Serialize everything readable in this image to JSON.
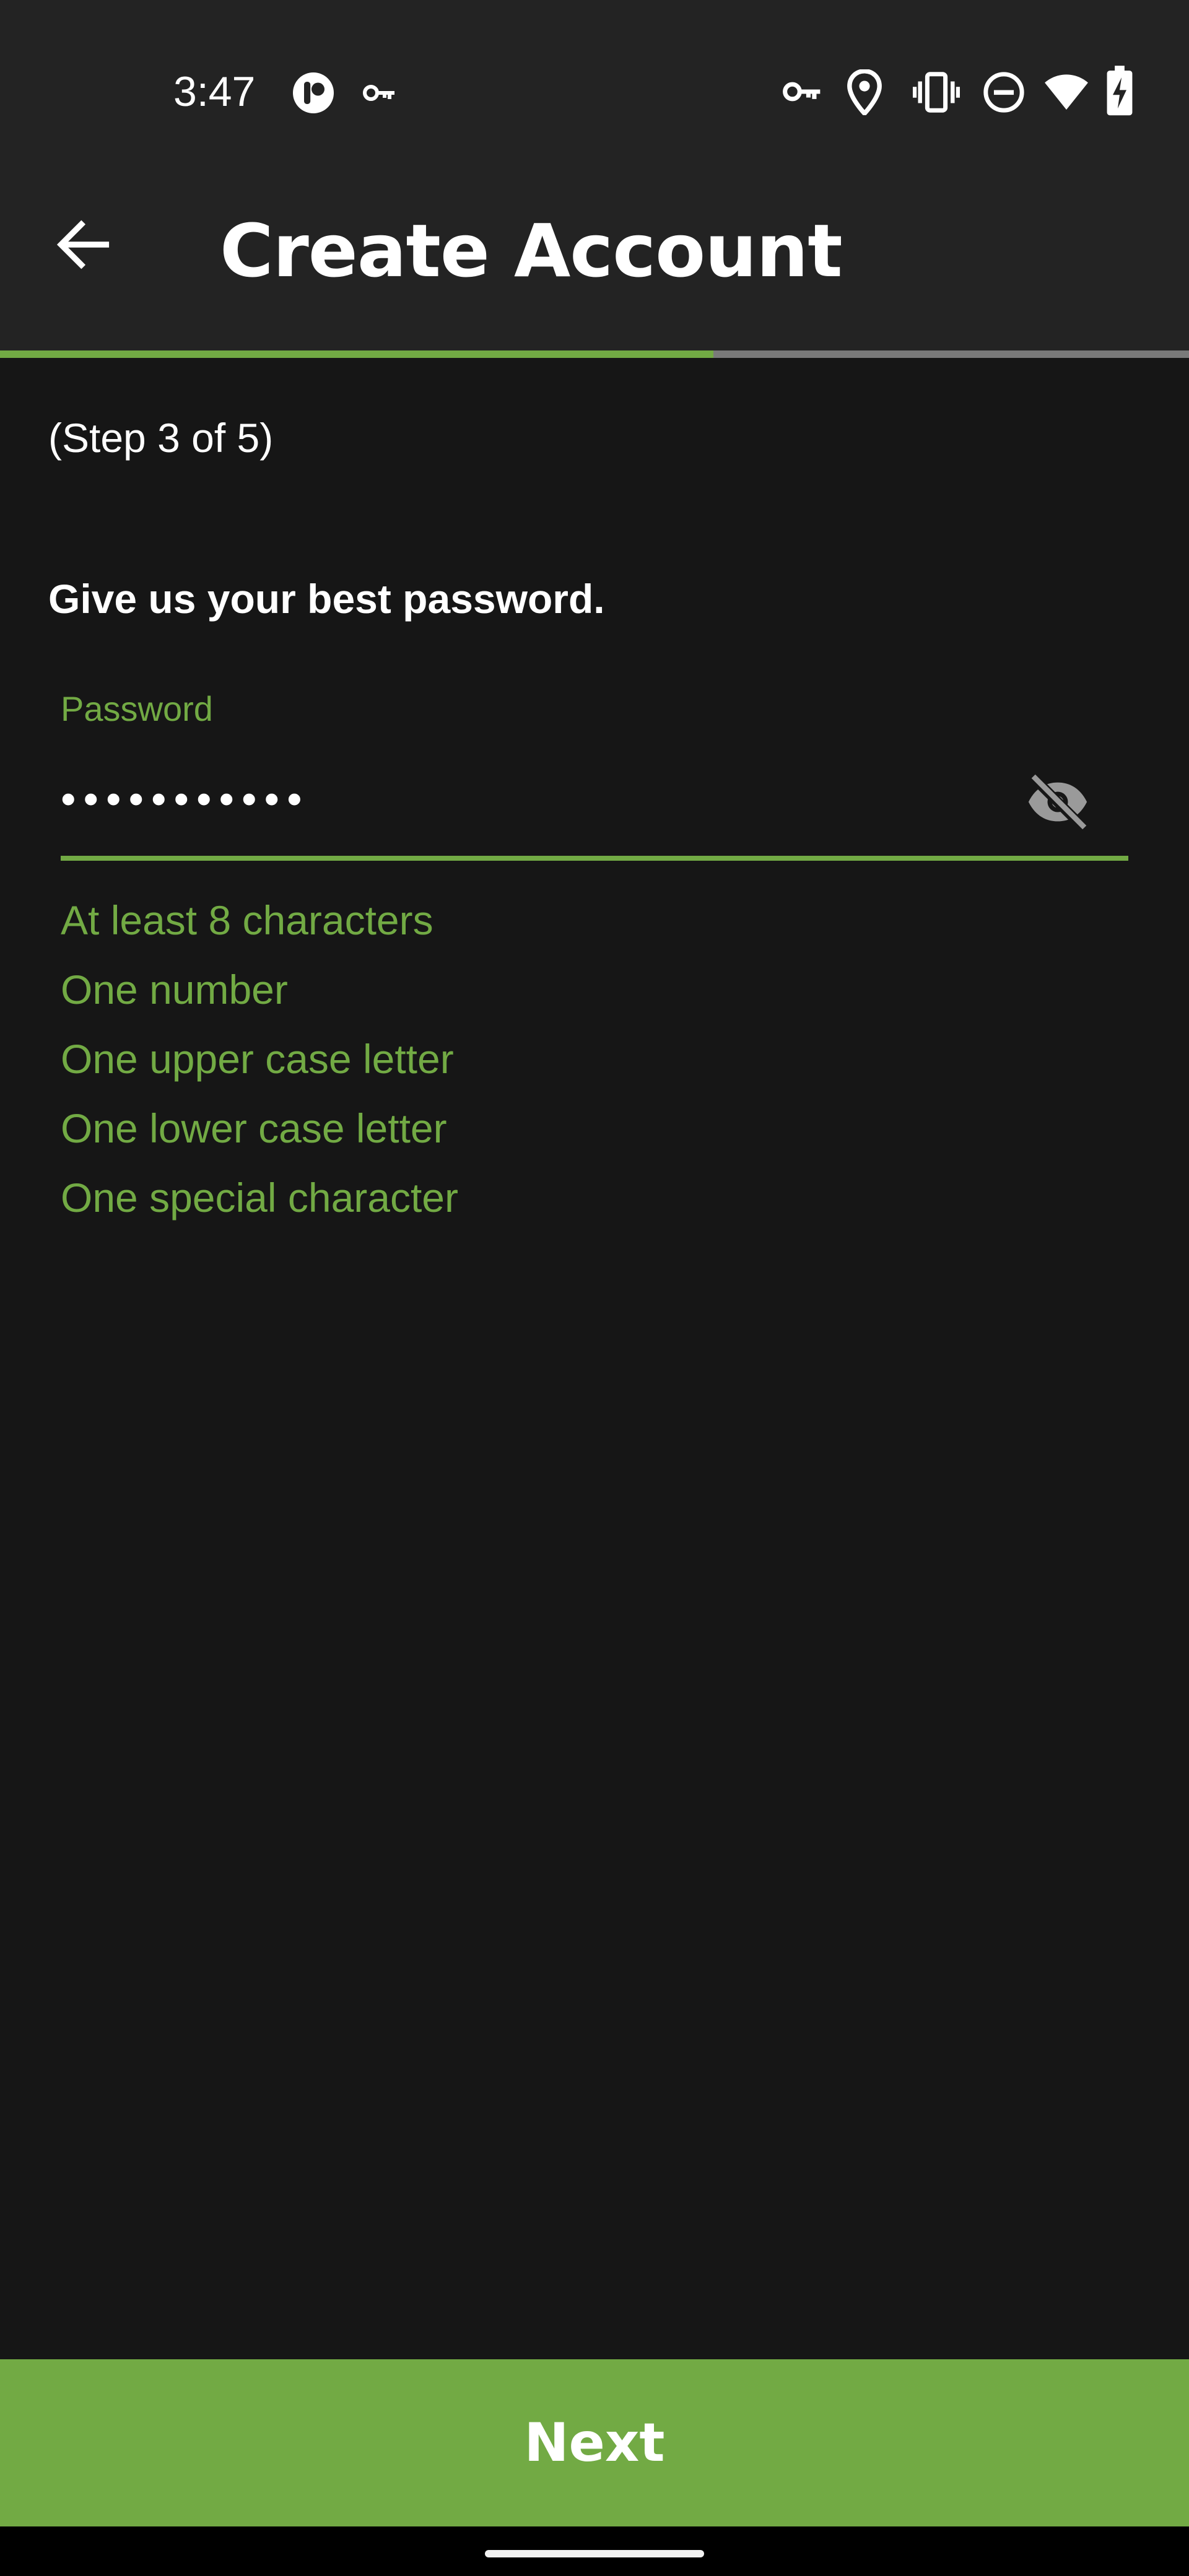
{
  "status_bar": {
    "time": "3:47",
    "left_icons": [
      "app-notification-icon",
      "vpn-key-icon"
    ],
    "right_icons": [
      "vpn-key-icon",
      "location-icon",
      "vibrate-icon",
      "do-not-disturb-icon",
      "wifi-icon",
      "battery-charging-icon"
    ]
  },
  "header": {
    "back_icon": "arrow-left-icon",
    "title": "Create Account"
  },
  "progress": {
    "current_step": 3,
    "total_steps": 5,
    "fraction": 0.6
  },
  "step_text": "(Step 3 of 5)",
  "prompt": "Give us your best password.",
  "password_field": {
    "label": "Password",
    "value": "•••••••••••",
    "toggle_icon": "eye-off-icon"
  },
  "requirements": [
    "At least 8 characters",
    "One number",
    "One upper case letter",
    "One lower case letter",
    "One special character"
  ],
  "next_button": {
    "label": "Next"
  },
  "colors": {
    "accent": "#72aa44",
    "background": "#161616",
    "app_bar": "#232323"
  }
}
